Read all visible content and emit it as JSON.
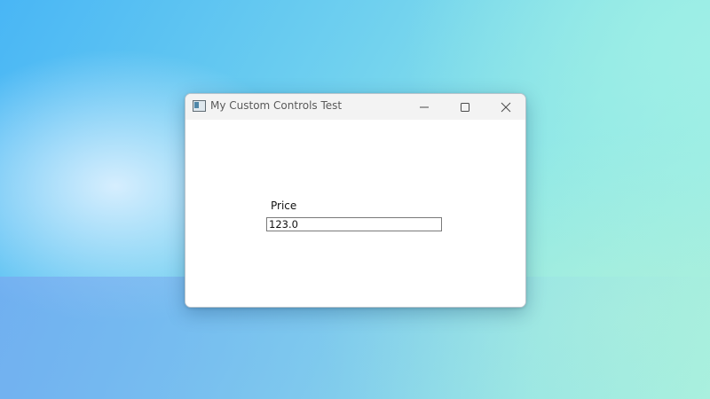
{
  "window": {
    "title": "My Custom Controls Test",
    "icon": "app-window-icon",
    "controls": {
      "minimize_icon": "minimize-icon",
      "maximize_icon": "maximize-icon",
      "close_icon": "close-icon"
    }
  },
  "form": {
    "price_label": "Price",
    "price_value": "123.0"
  },
  "colors": {
    "titlebar": "#f3f3f3",
    "window_background": "#ffffff",
    "input_border": "#7a7a7a"
  }
}
